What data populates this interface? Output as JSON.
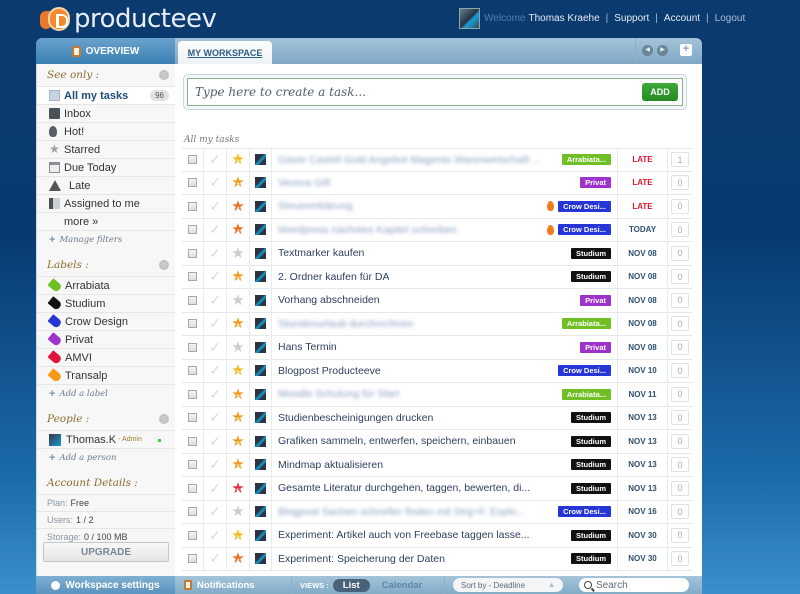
{
  "app": {
    "name": "producteev"
  },
  "header": {
    "welcome": "Welcome",
    "user_name": "Thomas Kraehe",
    "links": {
      "support": "Support",
      "account": "Account",
      "logout": "Logout"
    },
    "separator": "|"
  },
  "tabs": {
    "overview": "OVERVIEW",
    "workspace": "MY WORKSPACE"
  },
  "sidebar": {
    "see_only": {
      "title": "See only :",
      "items": [
        {
          "label": "All my tasks",
          "icon": "document-icon",
          "count": "96",
          "active": true
        },
        {
          "label": "Inbox",
          "icon": "inbox-icon"
        },
        {
          "label": "Hot!",
          "icon": "flame-icon"
        },
        {
          "label": "Starred",
          "icon": "star-icon"
        },
        {
          "label": "Due Today",
          "icon": "calendar-icon"
        },
        {
          "label": "Late",
          "icon": "warning-icon"
        },
        {
          "label": "Assigned to me",
          "icon": "assign-icon"
        }
      ],
      "more": "more »",
      "manage": "Manage filters"
    },
    "labels": {
      "title": "Labels :",
      "items": [
        {
          "label": "Arrabiata",
          "color": "#6fbf25"
        },
        {
          "label": "Studium",
          "color": "#111111"
        },
        {
          "label": "Crow Design",
          "color": "#2535d6"
        },
        {
          "label": "Privat",
          "color": "#9d33cc"
        },
        {
          "label": "AMVI",
          "color": "#e0143a"
        },
        {
          "label": "Transalp",
          "color": "#f59b18"
        }
      ],
      "add": "Add a label"
    },
    "people": {
      "title": "People :",
      "items": [
        {
          "name": "Thomas.K",
          "role": "- Admin",
          "online": true
        }
      ],
      "add": "Add a person"
    },
    "account": {
      "title": "Account Details :",
      "plan_label": "Plan:",
      "plan": "Free",
      "users_label": "Users:",
      "users": "1 / 2",
      "storage_label": "Storage:",
      "storage": "0 / 100 MB",
      "upgrade": "UPGRADE"
    },
    "settings": "Workspace settings"
  },
  "main": {
    "new_task_placeholder": "Type here to create a task...",
    "add_button": "ADD",
    "list_title": "All my tasks",
    "tasks": [
      {
        "title": "Gäste Castell Gold Angebot Magento Warenwirtschaft ...",
        "blurred": true,
        "priority": 2,
        "star": "#f2b81c",
        "hot": false,
        "label": "Arrabiata...",
        "label_color": "#6fbf25",
        "due": "LATE",
        "late": true,
        "comments": "1"
      },
      {
        "title": "Verena Gift",
        "blurred": true,
        "priority": 3,
        "star": "#f09a1c",
        "hot": false,
        "label": "Privat",
        "label_color": "#9d33cc",
        "due": "LATE",
        "late": true,
        "comments": "0"
      },
      {
        "title": "Steuererklärung",
        "blurred": true,
        "priority": 4,
        "star": "#ec6b1f",
        "hot": true,
        "label": "Crow Desi...",
        "label_color": "#2535d6",
        "due": "LATE",
        "late": true,
        "comments": "0"
      },
      {
        "title": "Wordpress nächstes Kapitel schreiben",
        "blurred": true,
        "priority": 4,
        "star": "#ec6b1f",
        "hot": true,
        "label": "Crow Desi...",
        "label_color": "#2535d6",
        "due": "TODAY",
        "late": false,
        "comments": "0"
      },
      {
        "title": "Textmarker kaufen",
        "blurred": false,
        "priority": 0,
        "star": "#c9cdd1",
        "hot": false,
        "label": "Studium",
        "label_color": "#111111",
        "due": "NOV 08",
        "late": false,
        "comments": "0"
      },
      {
        "title": "2. Ordner kaufen für DA",
        "blurred": false,
        "priority": 3,
        "star": "#f09a1c",
        "hot": false,
        "label": "Studium",
        "label_color": "#111111",
        "due": "NOV 08",
        "late": false,
        "comments": "0"
      },
      {
        "title": "Vorhang abschneiden",
        "blurred": false,
        "priority": 0,
        "star": "#c9cdd1",
        "hot": false,
        "label": "Privat",
        "label_color": "#9d33cc",
        "due": "NOV 08",
        "late": false,
        "comments": "0"
      },
      {
        "title": "Stundenurlaub durchrechnen",
        "blurred": true,
        "priority": 3,
        "star": "#f09a1c",
        "hot": false,
        "label": "Arrabiata...",
        "label_color": "#6fbf25",
        "due": "NOV 08",
        "late": false,
        "comments": "0"
      },
      {
        "title": "Hans Termin",
        "blurred": false,
        "priority": 0,
        "star": "#c9cdd1",
        "hot": false,
        "label": "Privat",
        "label_color": "#9d33cc",
        "due": "NOV 08",
        "late": false,
        "comments": "0"
      },
      {
        "title": "Blogpost Producteeve",
        "blurred": false,
        "priority": 2,
        "star": "#f2b81c",
        "hot": false,
        "label": "Crow Desi...",
        "label_color": "#2535d6",
        "due": "NOV 10",
        "late": false,
        "comments": "0"
      },
      {
        "title": "Moodle Schulung für Start",
        "blurred": true,
        "priority": 3,
        "star": "#f09a1c",
        "hot": false,
        "label": "Arrabiata...",
        "label_color": "#6fbf25",
        "due": "NOV 11",
        "late": false,
        "comments": "0"
      },
      {
        "title": "Studienbescheinigungen drucken",
        "blurred": false,
        "priority": 3,
        "star": "#f09a1c",
        "hot": false,
        "label": "Studium",
        "label_color": "#111111",
        "due": "NOV 13",
        "late": false,
        "comments": "0"
      },
      {
        "title": "Grafiken sammeln, entwerfen, speichern, einbauen",
        "blurred": false,
        "priority": 3,
        "star": "#f09a1c",
        "hot": false,
        "label": "Studium",
        "label_color": "#111111",
        "due": "NOV 13",
        "late": false,
        "comments": "0"
      },
      {
        "title": "Mindmap aktualisieren",
        "blurred": false,
        "priority": 3,
        "star": "#f09a1c",
        "hot": false,
        "label": "Studium",
        "label_color": "#111111",
        "due": "NOV 13",
        "late": false,
        "comments": "0"
      },
      {
        "title": "Gesamte Literatur durchgehen, taggen, bewerten, di...",
        "blurred": false,
        "priority": 5,
        "star": "#e52a3a",
        "hot": false,
        "label": "Studium",
        "label_color": "#111111",
        "due": "NOV 13",
        "late": false,
        "comments": "0"
      },
      {
        "title": "Blogpost Sachen schneller finden mit Strg+F. Explo...",
        "blurred": true,
        "priority": 0,
        "star": "#c9cdd1",
        "hot": false,
        "label": "Crow Desi...",
        "label_color": "#2535d6",
        "due": "NOV 16",
        "late": false,
        "comments": "0"
      },
      {
        "title": "Experiment: Artikel auch von Freebase taggen lasse...",
        "blurred": false,
        "priority": 2,
        "star": "#f2b81c",
        "hot": false,
        "label": "Studium",
        "label_color": "#111111",
        "due": "NOV 30",
        "late": false,
        "comments": "0"
      },
      {
        "title": "Experiment: Speicherung der Daten",
        "blurred": false,
        "priority": 4,
        "star": "#ec6b1f",
        "hot": false,
        "label": "Studium",
        "label_color": "#111111",
        "due": "NOV 30",
        "late": false,
        "comments": "0"
      }
    ]
  },
  "bottombar": {
    "notifications": "Notifications",
    "views_label": "VIEWS :",
    "view_list": "List",
    "view_calendar": "Calendar",
    "sort": "Sort by - Deadline",
    "search_placeholder": "Search"
  }
}
